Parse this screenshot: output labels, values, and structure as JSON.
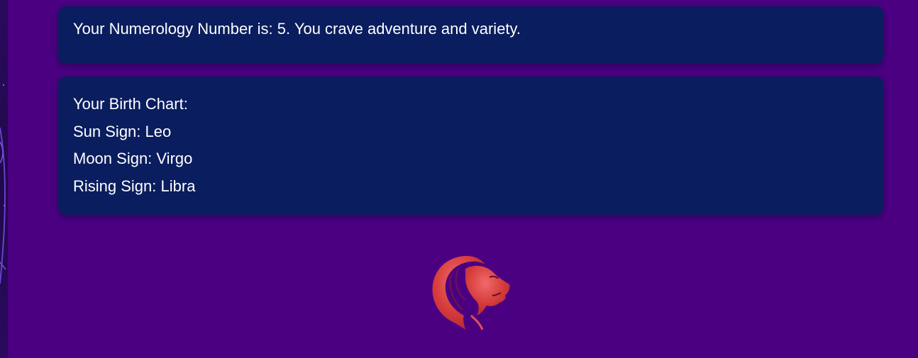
{
  "numerology": {
    "text": "Your Numerology Number is: 5. You crave adventure and variety."
  },
  "birth_chart": {
    "heading": "Your Birth Chart:",
    "sun": "Sun Sign: Leo",
    "moon": "Moon Sign: Virgo",
    "rising": "Rising Sign: Libra"
  },
  "emblem": {
    "icon": "leo-lion-icon",
    "color": "#d63a3a"
  },
  "colors": {
    "background": "#4b0082",
    "card": "#0a1d5e",
    "text": "#ffffff"
  }
}
